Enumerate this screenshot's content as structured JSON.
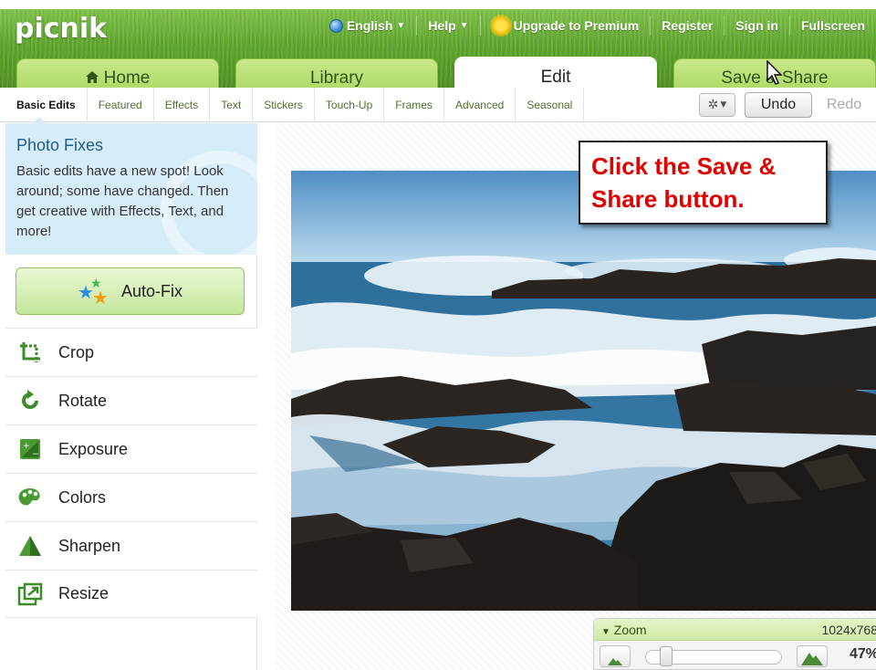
{
  "app": {
    "logo_text": "picnik"
  },
  "topnav": {
    "language": "English",
    "help": "Help",
    "upgrade": "Upgrade to Premium",
    "register": "Register",
    "signin": "Sign in",
    "fullscreen": "Fullscreen"
  },
  "tabs": [
    {
      "label": "Home",
      "icon": "home-icon"
    },
    {
      "label": "Library"
    },
    {
      "label": "Edit",
      "active": true
    },
    {
      "label": "Save & Share"
    }
  ],
  "subtabs": [
    "Basic Edits",
    "Featured",
    "Effects",
    "Text",
    "Stickers",
    "Touch-Up",
    "Frames",
    "Advanced",
    "Seasonal"
  ],
  "toolbar": {
    "undo": "Undo",
    "redo": "Redo"
  },
  "tip": {
    "title": "Photo Fixes",
    "text": "Basic edits have a new spot! Look around; some have changed. Then get creative with Effects, Text, and more!"
  },
  "autofix": {
    "label": "Auto-Fix"
  },
  "tools": [
    {
      "label": "Crop",
      "icon": "crop-icon"
    },
    {
      "label": "Rotate",
      "icon": "rotate-icon"
    },
    {
      "label": "Exposure",
      "icon": "exposure-icon"
    },
    {
      "label": "Colors",
      "icon": "palette-icon"
    },
    {
      "label": "Sharpen",
      "icon": "sharpen-icon"
    },
    {
      "label": "Resize",
      "icon": "resize-icon"
    }
  ],
  "callout": {
    "line1": "Click the Save &",
    "line2": "Share button."
  },
  "zoom": {
    "label": "Zoom",
    "size": "1024x768",
    "percent": "47%",
    "level": 0.1
  },
  "colors": {
    "header_green": "#5fa52c",
    "tab_green": "#b5dd72",
    "accent_blue": "#1f5c8b",
    "callout_red": "#e00000"
  }
}
